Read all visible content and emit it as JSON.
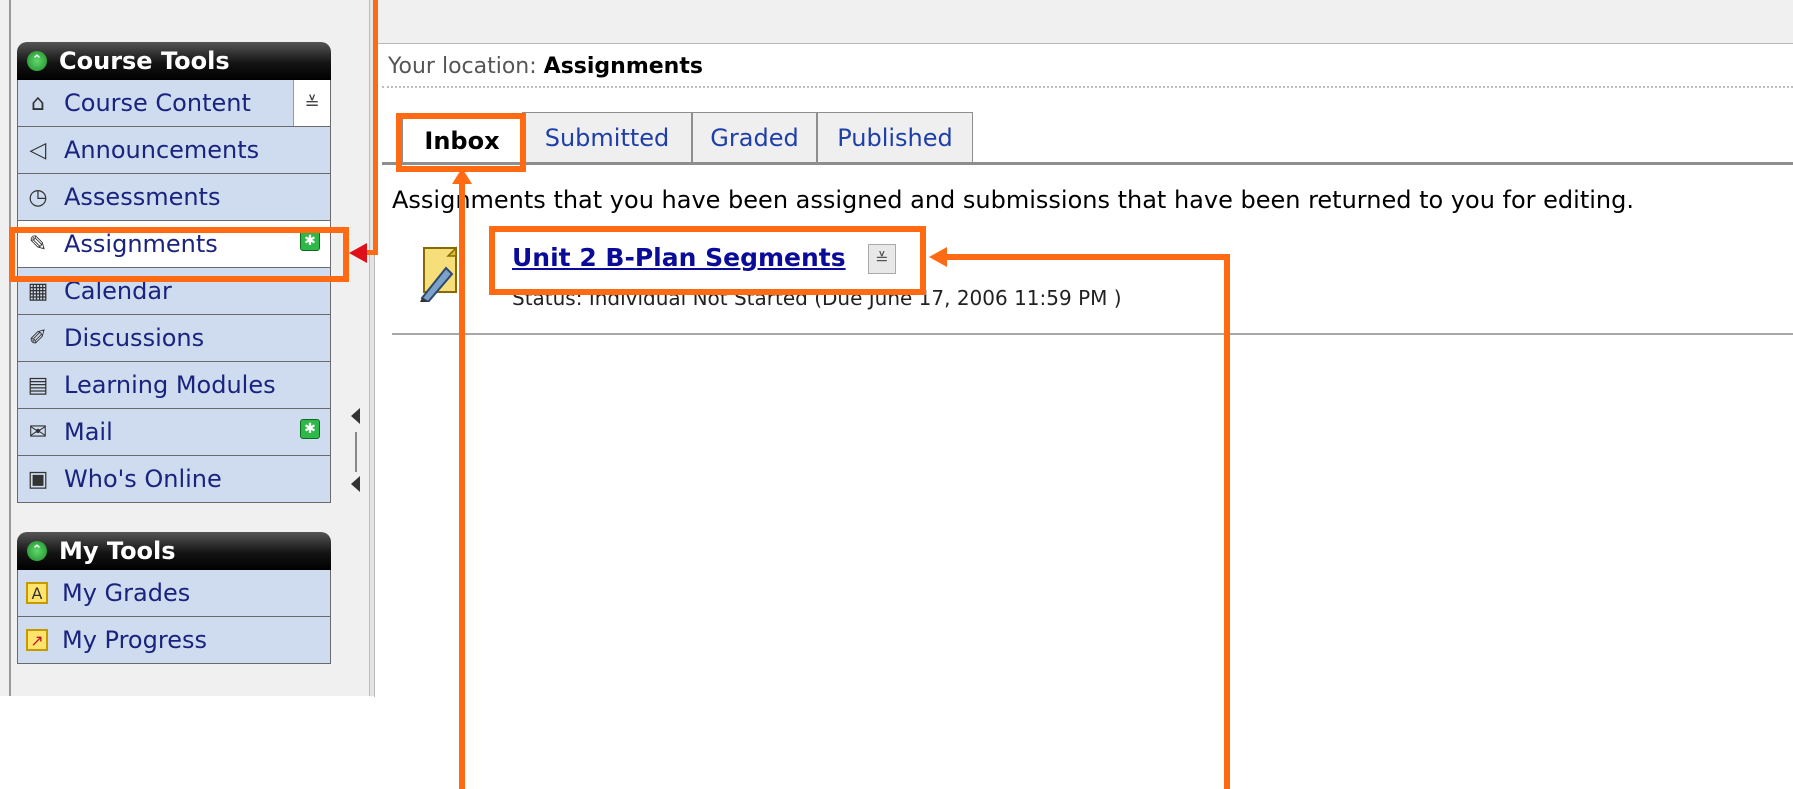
{
  "sidebar": {
    "course_tools": {
      "title": "Course Tools",
      "items": [
        {
          "label": "Course Content",
          "icon": "home-icon",
          "active": false
        },
        {
          "label": "Announcements",
          "icon": "megaphone-icon",
          "active": false
        },
        {
          "label": "Assessments",
          "icon": "stopwatch-icon",
          "active": false
        },
        {
          "label": "Assignments",
          "icon": "assignment-pencil-icon",
          "active": true,
          "new": true
        },
        {
          "label": "Calendar",
          "icon": "calendar-icon",
          "active": false
        },
        {
          "label": "Discussions",
          "icon": "pushpin-icon",
          "active": false
        },
        {
          "label": "Learning Modules",
          "icon": "document-icon",
          "active": false
        },
        {
          "label": "Mail",
          "icon": "envelope-icon",
          "active": false,
          "new": true
        },
        {
          "label": "Who's Online",
          "icon": "person-card-icon",
          "active": false
        }
      ]
    },
    "my_tools": {
      "title": "My Tools",
      "items": [
        {
          "label": "My Grades",
          "icon": "grade-a-icon"
        },
        {
          "label": "My Progress",
          "icon": "progress-chart-icon"
        }
      ]
    }
  },
  "breadcrumb": {
    "prefix": "Your location:",
    "current": "Assignments"
  },
  "tabs": [
    {
      "label": "Inbox",
      "active": true
    },
    {
      "label": "Submitted",
      "active": false
    },
    {
      "label": "Graded",
      "active": false
    },
    {
      "label": "Published",
      "active": false
    }
  ],
  "description": "Assignments that you have been assigned and submissions that have been returned to you for editing.",
  "assignment": {
    "title": "Unit 2 B-Plan Segments",
    "status": "Status: Individual Not Started (Due June 17, 2006 11:59 PM )"
  },
  "colors": {
    "annotation": "#ff6a13",
    "nav_bg": "#cfdcef",
    "link": "#0b0b9a"
  }
}
